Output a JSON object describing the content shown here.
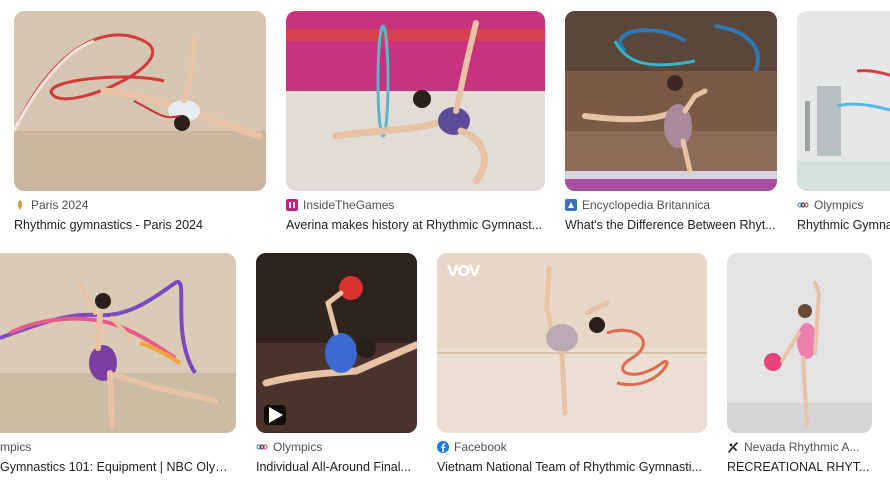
{
  "results": [
    {
      "source": "Paris 2024",
      "title": "Rhythmic gymnastics - Paris 2024",
      "favicon": "paris-2024-icon"
    },
    {
      "source": "InsideTheGames",
      "title": "Averina makes history at Rhythmic Gymnast...",
      "favicon": "insidethegames-icon"
    },
    {
      "source": "Encyclopedia Britannica",
      "title": "What's the Difference Between Rhyt...",
      "favicon": "britannica-icon"
    },
    {
      "source": "Olympics",
      "title": "Rhythmic Gymna",
      "favicon": "olympics-rings-icon"
    },
    {
      "source": "mpics",
      "title": "Gymnastics 101: Equipment | NBC Olymp...",
      "favicon": "olympics-rings-icon"
    },
    {
      "source": "Olympics",
      "title": "Individual All-Around Final...",
      "favicon": "olympics-rings-icon",
      "has_video": true
    },
    {
      "source": "Facebook",
      "title": "Vietnam National Team of Rhythmic Gymnasti...",
      "favicon": "facebook-icon",
      "watermark": "VOV"
    },
    {
      "source": "Nevada Rhythmic A...",
      "title": "RECREATIONAL RHYT...",
      "favicon": "gymnast-icon"
    }
  ],
  "colors": {
    "source_text": "#4d5156",
    "title_text": "#202124",
    "facebook_blue": "#1877f2",
    "insidethegames_pink": "#c0267f",
    "britannica_blue": "#3d6fb6",
    "paris_gold": "#c9a44b"
  }
}
